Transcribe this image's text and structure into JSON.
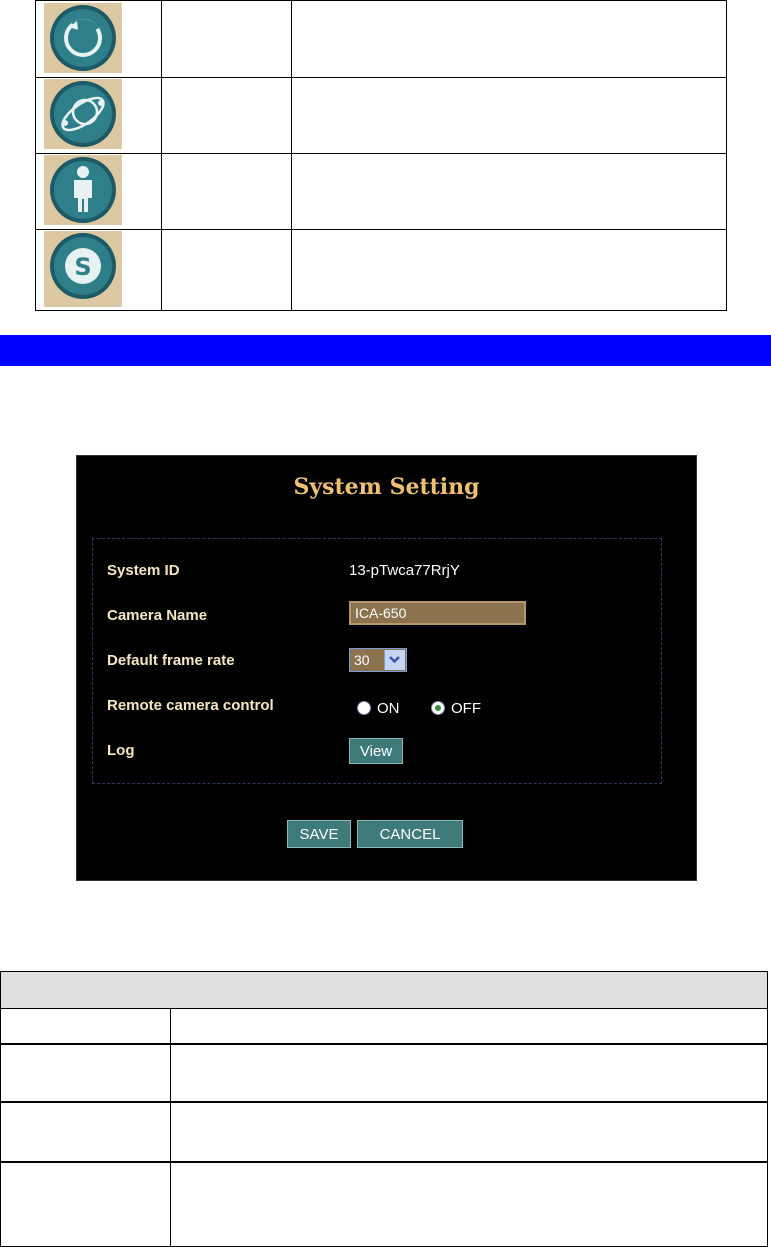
{
  "icon_table": {
    "rows": [
      {
        "icon": "rotate-circle-icon",
        "name": "",
        "description": ""
      },
      {
        "icon": "orbit-icon",
        "name": "",
        "description": ""
      },
      {
        "icon": "person-icon",
        "name": "",
        "description": ""
      },
      {
        "icon": "s-letter-icon",
        "name": "",
        "description": ""
      }
    ]
  },
  "colors": {
    "section_bar": "#0000ff",
    "panel_background": "#000000",
    "title_color": "#f0c070",
    "button_color": "#3f7a7a",
    "input_color": "#8b7350"
  },
  "system_setting": {
    "title": "System Setting",
    "system_id_label": "System ID",
    "system_id_value": "13-pTwca77RrjY",
    "camera_name_label": "Camera Name",
    "camera_name_value": "ICA-650",
    "frame_rate_label": "Default frame rate",
    "frame_rate_value": "30",
    "remote_control_label": "Remote camera control",
    "remote_control_options": [
      "ON",
      "OFF"
    ],
    "remote_control_selected": "OFF",
    "log_label": "Log",
    "view_button": "View",
    "save_button": "SAVE",
    "cancel_button": "CANCEL"
  },
  "bottom_table": {
    "header": "",
    "rows": [
      {
        "col1": "",
        "col2": ""
      },
      {
        "col1": "",
        "col2": ""
      },
      {
        "col1": "",
        "col2": ""
      },
      {
        "col1": "",
        "col2": ""
      }
    ]
  }
}
